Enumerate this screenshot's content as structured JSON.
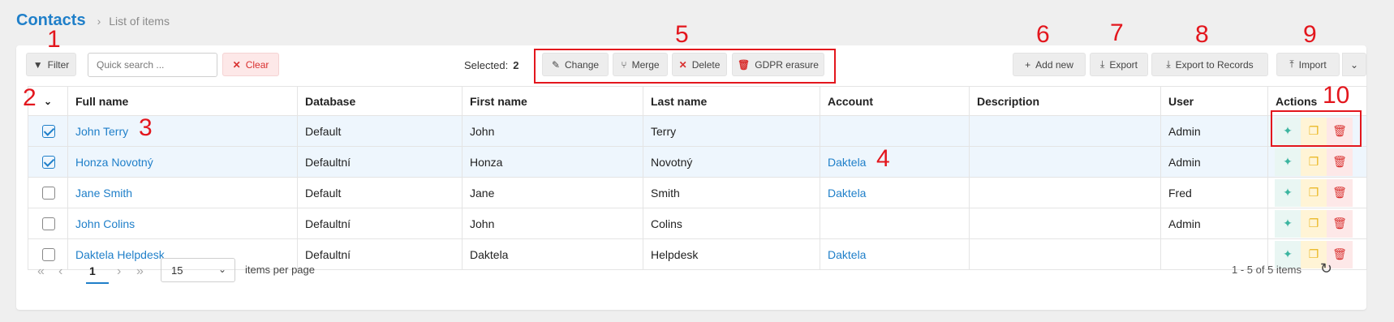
{
  "header": {
    "title": "Contacts",
    "breadcrumb": "List of items"
  },
  "toolbar": {
    "filter_label": "Filter",
    "search_placeholder": "Quick search ...",
    "clear_label": "Clear",
    "selected_label": "Selected:",
    "selected_count": "2",
    "change_label": "Change",
    "merge_label": "Merge",
    "delete_label": "Delete",
    "gdpr_label": "GDPR erasure",
    "add_new_label": "Add new",
    "export_label": "Export",
    "export_records_label": "Export to Records",
    "import_label": "Import"
  },
  "table": {
    "columns": [
      "Full name",
      "Database",
      "First name",
      "Last name",
      "Account",
      "Description",
      "User",
      "Actions"
    ],
    "rows": [
      {
        "full_name": "John Terry",
        "database": "Default",
        "first": "John",
        "last": "Terry",
        "account": "",
        "description": "",
        "user": "Admin",
        "selected": true
      },
      {
        "full_name": "Honza Novotný",
        "database": "Defaultní",
        "first": "Honza",
        "last": "Novotný",
        "account": "Daktela",
        "description": "",
        "user": "Admin",
        "selected": true
      },
      {
        "full_name": "Jane Smith",
        "database": "Default",
        "first": "Jane",
        "last": "Smith",
        "account": "Daktela",
        "description": "",
        "user": "Fred",
        "selected": false
      },
      {
        "full_name": "John Colins",
        "database": "Defaultní",
        "first": "John",
        "last": "Colins",
        "account": "",
        "description": "",
        "user": "Admin",
        "selected": false
      },
      {
        "full_name": "Daktela Helpdesk",
        "database": "Defaultní",
        "first": "Daktela",
        "last": "Helpdesk",
        "account": "Daktela",
        "description": "",
        "user": "",
        "selected": false
      }
    ]
  },
  "pagination": {
    "current_page": "1",
    "per_page": "15",
    "per_page_label": "items per page",
    "summary": "1 - 5 of 5 items"
  },
  "annotations": [
    "1",
    "2",
    "3",
    "4",
    "5",
    "6",
    "7",
    "8",
    "9",
    "10"
  ],
  "colors": {
    "accent": "#1f7fc9",
    "annotation": "#e3161d",
    "danger": "#d9302f"
  }
}
